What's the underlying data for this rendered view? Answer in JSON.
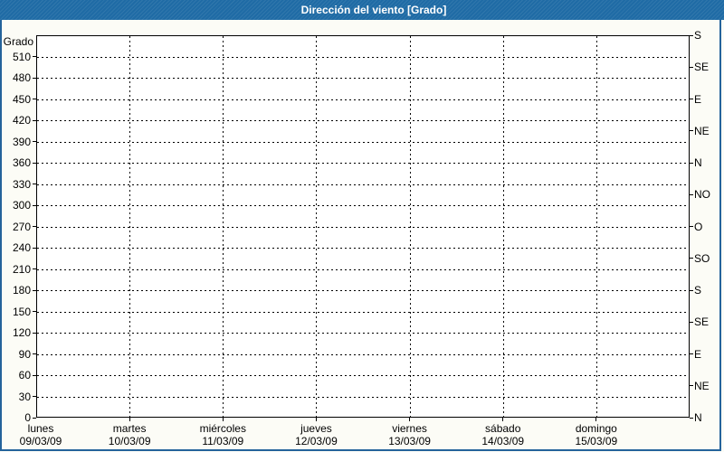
{
  "window": {
    "title": "Dirección del viento [Grado]"
  },
  "colors": {
    "titlebar": "#1f6ba5",
    "titlebar_text": "#ffffff",
    "border": "#24639b",
    "page_bg": "#fcfcf6",
    "plot_bg": "#ffffff",
    "grid": "#000000"
  },
  "chart_data": {
    "type": "line",
    "title": "Dirección del viento [Grado]",
    "series": [],
    "grid": "dashed",
    "ylim": [
      0,
      540
    ],
    "y_axis_left": {
      "label": "Grado",
      "min": 0,
      "max": 540,
      "tick_step": 30,
      "tick_labels": [
        "0",
        "30",
        "60",
        "90",
        "120",
        "150",
        "180",
        "210",
        "240",
        "270",
        "300",
        "330",
        "360",
        "390",
        "420",
        "450",
        "480",
        "510"
      ]
    },
    "y_axis_right": {
      "tick_step": 45,
      "ticks": [
        {
          "value": 540,
          "label": "S"
        },
        {
          "value": 495,
          "label": "SE"
        },
        {
          "value": 450,
          "label": "E"
        },
        {
          "value": 405,
          "label": "NE"
        },
        {
          "value": 360,
          "label": "N"
        },
        {
          "value": 315,
          "label": "NO"
        },
        {
          "value": 270,
          "label": "O"
        },
        {
          "value": 225,
          "label": "SO"
        },
        {
          "value": 180,
          "label": "S"
        },
        {
          "value": 135,
          "label": "SE"
        },
        {
          "value": 90,
          "label": "E"
        },
        {
          "value": 45,
          "label": "NE"
        },
        {
          "value": 0,
          "label": "N"
        }
      ]
    },
    "x_axis": {
      "days": [
        {
          "name": "lunes",
          "date": "09/03/09"
        },
        {
          "name": "martes",
          "date": "10/03/09"
        },
        {
          "name": "miércoles",
          "date": "11/03/09"
        },
        {
          "name": "jueves",
          "date": "12/03/09"
        },
        {
          "name": "viernes",
          "date": "13/03/09"
        },
        {
          "name": "sábado",
          "date": "14/03/09"
        },
        {
          "name": "domingo",
          "date": "15/03/09"
        }
      ]
    }
  }
}
